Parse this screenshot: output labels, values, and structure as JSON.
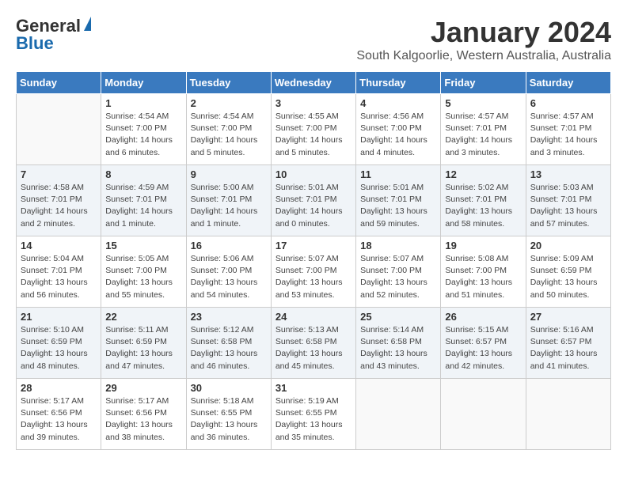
{
  "header": {
    "logo_general": "General",
    "logo_blue": "Blue",
    "title": "January 2024",
    "subtitle": "South Kalgoorlie, Western Australia, Australia"
  },
  "days_of_week": [
    "Sunday",
    "Monday",
    "Tuesday",
    "Wednesday",
    "Thursday",
    "Friday",
    "Saturday"
  ],
  "weeks": [
    {
      "days": [
        {
          "num": "",
          "text": ""
        },
        {
          "num": "1",
          "text": "Sunrise: 4:54 AM\nSunset: 7:00 PM\nDaylight: 14 hours\nand 6 minutes."
        },
        {
          "num": "2",
          "text": "Sunrise: 4:54 AM\nSunset: 7:00 PM\nDaylight: 14 hours\nand 5 minutes."
        },
        {
          "num": "3",
          "text": "Sunrise: 4:55 AM\nSunset: 7:00 PM\nDaylight: 14 hours\nand 5 minutes."
        },
        {
          "num": "4",
          "text": "Sunrise: 4:56 AM\nSunset: 7:00 PM\nDaylight: 14 hours\nand 4 minutes."
        },
        {
          "num": "5",
          "text": "Sunrise: 4:57 AM\nSunset: 7:01 PM\nDaylight: 14 hours\nand 3 minutes."
        },
        {
          "num": "6",
          "text": "Sunrise: 4:57 AM\nSunset: 7:01 PM\nDaylight: 14 hours\nand 3 minutes."
        }
      ]
    },
    {
      "days": [
        {
          "num": "7",
          "text": "Sunrise: 4:58 AM\nSunset: 7:01 PM\nDaylight: 14 hours\nand 2 minutes."
        },
        {
          "num": "8",
          "text": "Sunrise: 4:59 AM\nSunset: 7:01 PM\nDaylight: 14 hours\nand 1 minute."
        },
        {
          "num": "9",
          "text": "Sunrise: 5:00 AM\nSunset: 7:01 PM\nDaylight: 14 hours\nand 1 minute."
        },
        {
          "num": "10",
          "text": "Sunrise: 5:01 AM\nSunset: 7:01 PM\nDaylight: 14 hours\nand 0 minutes."
        },
        {
          "num": "11",
          "text": "Sunrise: 5:01 AM\nSunset: 7:01 PM\nDaylight: 13 hours\nand 59 minutes."
        },
        {
          "num": "12",
          "text": "Sunrise: 5:02 AM\nSunset: 7:01 PM\nDaylight: 13 hours\nand 58 minutes."
        },
        {
          "num": "13",
          "text": "Sunrise: 5:03 AM\nSunset: 7:01 PM\nDaylight: 13 hours\nand 57 minutes."
        }
      ]
    },
    {
      "days": [
        {
          "num": "14",
          "text": "Sunrise: 5:04 AM\nSunset: 7:01 PM\nDaylight: 13 hours\nand 56 minutes."
        },
        {
          "num": "15",
          "text": "Sunrise: 5:05 AM\nSunset: 7:00 PM\nDaylight: 13 hours\nand 55 minutes."
        },
        {
          "num": "16",
          "text": "Sunrise: 5:06 AM\nSunset: 7:00 PM\nDaylight: 13 hours\nand 54 minutes."
        },
        {
          "num": "17",
          "text": "Sunrise: 5:07 AM\nSunset: 7:00 PM\nDaylight: 13 hours\nand 53 minutes."
        },
        {
          "num": "18",
          "text": "Sunrise: 5:07 AM\nSunset: 7:00 PM\nDaylight: 13 hours\nand 52 minutes."
        },
        {
          "num": "19",
          "text": "Sunrise: 5:08 AM\nSunset: 7:00 PM\nDaylight: 13 hours\nand 51 minutes."
        },
        {
          "num": "20",
          "text": "Sunrise: 5:09 AM\nSunset: 6:59 PM\nDaylight: 13 hours\nand 50 minutes."
        }
      ]
    },
    {
      "days": [
        {
          "num": "21",
          "text": "Sunrise: 5:10 AM\nSunset: 6:59 PM\nDaylight: 13 hours\nand 48 minutes."
        },
        {
          "num": "22",
          "text": "Sunrise: 5:11 AM\nSunset: 6:59 PM\nDaylight: 13 hours\nand 47 minutes."
        },
        {
          "num": "23",
          "text": "Sunrise: 5:12 AM\nSunset: 6:58 PM\nDaylight: 13 hours\nand 46 minutes."
        },
        {
          "num": "24",
          "text": "Sunrise: 5:13 AM\nSunset: 6:58 PM\nDaylight: 13 hours\nand 45 minutes."
        },
        {
          "num": "25",
          "text": "Sunrise: 5:14 AM\nSunset: 6:58 PM\nDaylight: 13 hours\nand 43 minutes."
        },
        {
          "num": "26",
          "text": "Sunrise: 5:15 AM\nSunset: 6:57 PM\nDaylight: 13 hours\nand 42 minutes."
        },
        {
          "num": "27",
          "text": "Sunrise: 5:16 AM\nSunset: 6:57 PM\nDaylight: 13 hours\nand 41 minutes."
        }
      ]
    },
    {
      "days": [
        {
          "num": "28",
          "text": "Sunrise: 5:17 AM\nSunset: 6:56 PM\nDaylight: 13 hours\nand 39 minutes."
        },
        {
          "num": "29",
          "text": "Sunrise: 5:17 AM\nSunset: 6:56 PM\nDaylight: 13 hours\nand 38 minutes."
        },
        {
          "num": "30",
          "text": "Sunrise: 5:18 AM\nSunset: 6:55 PM\nDaylight: 13 hours\nand 36 minutes."
        },
        {
          "num": "31",
          "text": "Sunrise: 5:19 AM\nSunset: 6:55 PM\nDaylight: 13 hours\nand 35 minutes."
        },
        {
          "num": "",
          "text": ""
        },
        {
          "num": "",
          "text": ""
        },
        {
          "num": "",
          "text": ""
        }
      ]
    }
  ]
}
